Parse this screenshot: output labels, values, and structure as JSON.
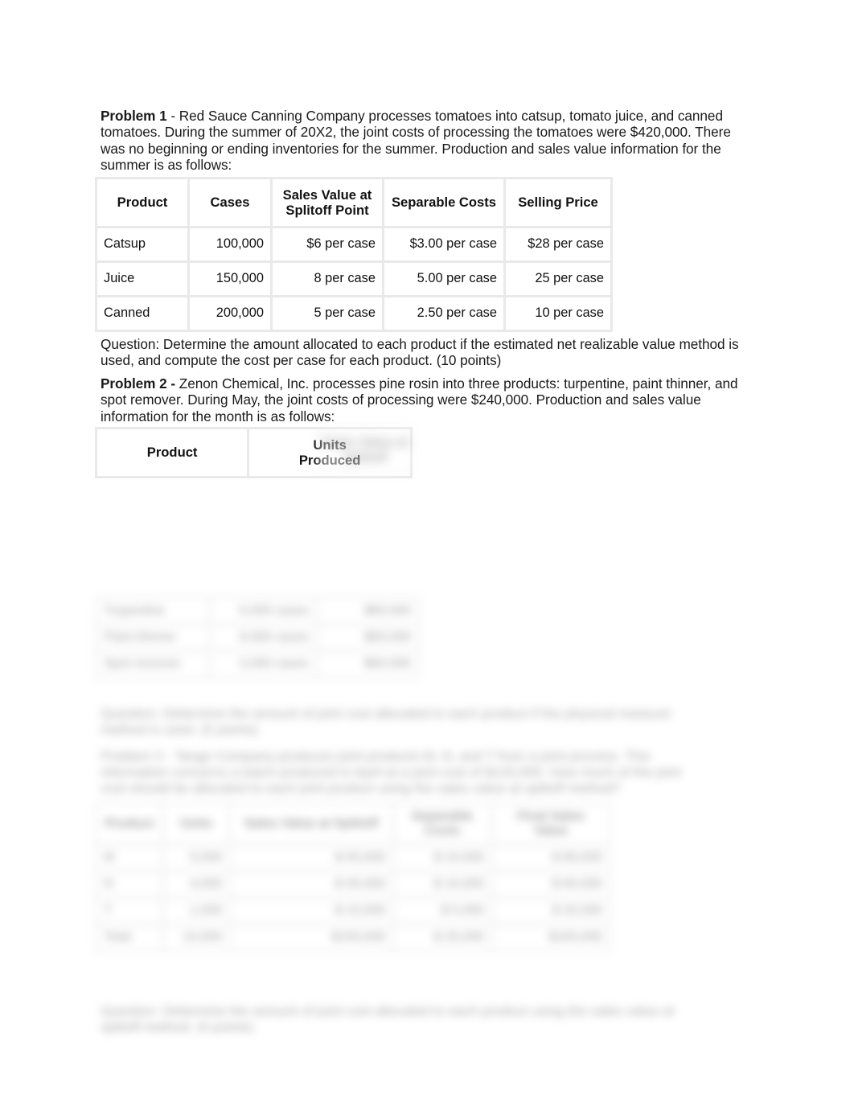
{
  "document": {
    "problem1": {
      "label": "Problem 1",
      "body": " - Red Sauce Canning Company processes tomatoes into catsup, tomato juice, and canned tomatoes. During the summer of 20X2, the joint costs of processing the tomatoes were $420,000. There was no beginning or ending inventories for the summer. Production and sales value information for the summer is as follows:",
      "table": {
        "headers": [
          "Product",
          "Cases",
          "Sales Value at Splitoff Point",
          "Separable Costs",
          "Selling Price"
        ],
        "headers_multiline": {
          "col3_line1": "Sales Value at",
          "col3_line2": "Splitoff Point"
        },
        "rows": [
          [
            "Catsup",
            "100,000",
            "$6 per case",
            "$3.00 per case",
            "$28 per case"
          ],
          [
            "Juice",
            "150,000",
            "8 per case",
            "5.00 per case",
            "25 per case"
          ],
          [
            "Canned",
            "200,000",
            "5 per case",
            "2.50 per case",
            "10 per case"
          ]
        ]
      },
      "question": "Question: Determine the amount allocated to each product if the estimated net realizable value method is used, and compute the cost per case for each product. (10 points)"
    },
    "problem2": {
      "label": "Problem 2 -",
      "body": " Zenon Chemical, Inc. processes pine rosin into three products: turpentine, paint thinner, and spot remover. During May, the joint costs of processing were $240,000. Production and sales value information for the month is as follows:",
      "table": {
        "headers": [
          "Product",
          "Units Produced",
          ""
        ],
        "headers_multiline": {
          "col2_line1": "Units",
          "col2_line2": "Produced"
        },
        "col3_obscured": "Sales Value at Splitoff",
        "rows_obscured": [
          [
            "Turpentine",
            "6,000 cases",
            "$60,000"
          ],
          [
            "Paint thinner",
            "6,000 cases",
            "$60,000"
          ],
          [
            "Spot remover",
            "3,000 cases",
            "$60,000"
          ]
        ]
      }
    },
    "obscured": {
      "paragraph1": "Question: Determine the amount of joint cost allocated to each product if the physical measure method is used. (5 points)",
      "paragraph2": "Problem 3 - Tango Company produces joint products M, N, and T from a joint process. This information concerns a batch produced in April at a joint cost of $120,000. How much of the joint cost should be allocated to each joint product using the sales value at splitoff method?",
      "table": {
        "headers": [
          "Product",
          "Units",
          "Sales Value at Splitoff",
          "Separable Costs",
          "Final Sales Value"
        ],
        "rows": [
          [
            "M",
            "5,000",
            "$ 50,000",
            "$ 10,000",
            "$ 80,000"
          ],
          [
            "N",
            "4,000",
            "$ 40,000",
            "$ 10,000",
            "$ 60,000"
          ],
          [
            "T",
            "1,000",
            "$ 10,000",
            "$  5,000",
            "$ 20,000"
          ],
          [
            "Total",
            "10,000",
            "$100,000",
            "$ 25,000",
            "$160,000"
          ]
        ]
      },
      "footer": "Question: Determine the amount of joint cost allocated to each product using the sales value at splitoff method. (5 points)"
    }
  }
}
